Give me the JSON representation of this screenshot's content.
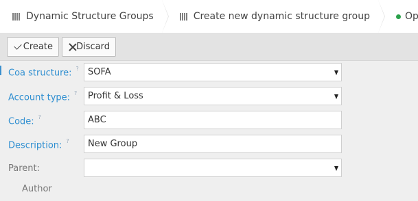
{
  "breadcrumbs": [
    {
      "label": "Dynamic Structure Groups"
    },
    {
      "label": "Create new dynamic structure group"
    },
    {
      "label": "Open"
    }
  ],
  "toolbar": {
    "create_label": "Create",
    "discard_label": "Discard"
  },
  "form": {
    "coa_structure": {
      "label": "Coa structure:",
      "help": "?",
      "value": "SOFA"
    },
    "account_type": {
      "label": "Account type:",
      "help": "?",
      "value": "Profit & Loss"
    },
    "code": {
      "label": "Code:",
      "help": "?",
      "value": "ABC"
    },
    "description": {
      "label": "Description:",
      "help": "?",
      "value": "New Group"
    },
    "parent": {
      "label": "Parent:",
      "value": ""
    }
  },
  "section": {
    "author_label": "Author"
  },
  "colors": {
    "status_open": "#2aa14b",
    "label_blue": "#2f8fd1"
  }
}
